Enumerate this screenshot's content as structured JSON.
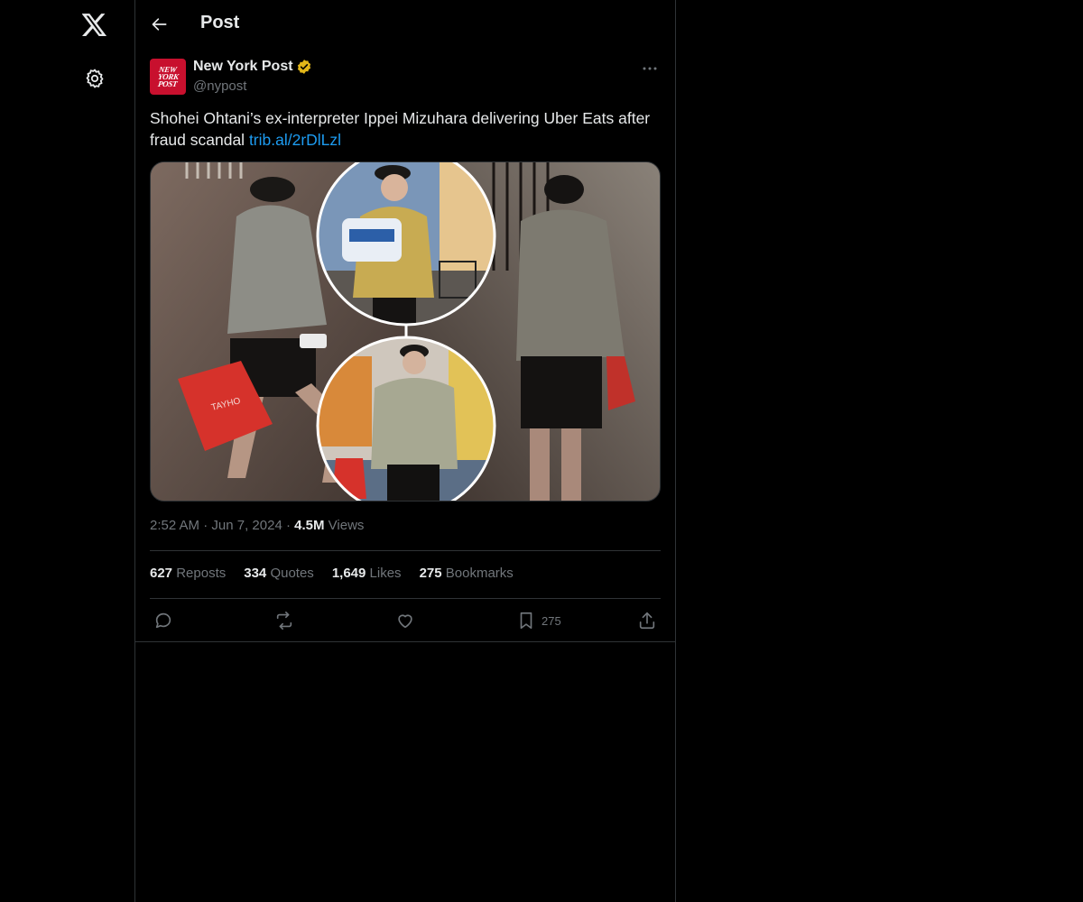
{
  "nav": {
    "logo_icon": "x-logo-icon",
    "settings_icon": "gear-icon"
  },
  "header": {
    "title": "Post",
    "back_icon": "arrow-left-icon"
  },
  "post": {
    "author": {
      "name": "New York Post",
      "handle": "@nypost",
      "verified": true,
      "verified_color": "#e2b719",
      "avatar_lines": [
        "NEW",
        "YORK",
        "POST"
      ],
      "avatar_color": "#c8102e"
    },
    "text": "Shohei Ohtani’s ex-interpreter Ippei Mizuhara delivering Uber Eats after fraud scandal ",
    "link": "trib.al/2rDlLzl",
    "media": {
      "bag_text": "TAYHO"
    },
    "time": "2:52 AM",
    "date": "Jun 7, 2024",
    "views_count": "4.5M",
    "views_label": "Views",
    "stats": [
      {
        "count": "627",
        "label": "Reposts"
      },
      {
        "count": "334",
        "label": "Quotes"
      },
      {
        "count": "1,649",
        "label": "Likes"
      },
      {
        "count": "275",
        "label": "Bookmarks"
      }
    ],
    "actions": {
      "reply_icon": "reply-icon",
      "repost_icon": "repost-icon",
      "like_icon": "heart-icon",
      "bookmark_icon": "bookmark-icon",
      "bookmark_count": "275",
      "share_icon": "share-icon"
    }
  },
  "colors": {
    "background": "#000000",
    "text": "#e7e9ea",
    "muted": "#71767b",
    "link": "#1d9bf0",
    "border": "#2f3336"
  }
}
